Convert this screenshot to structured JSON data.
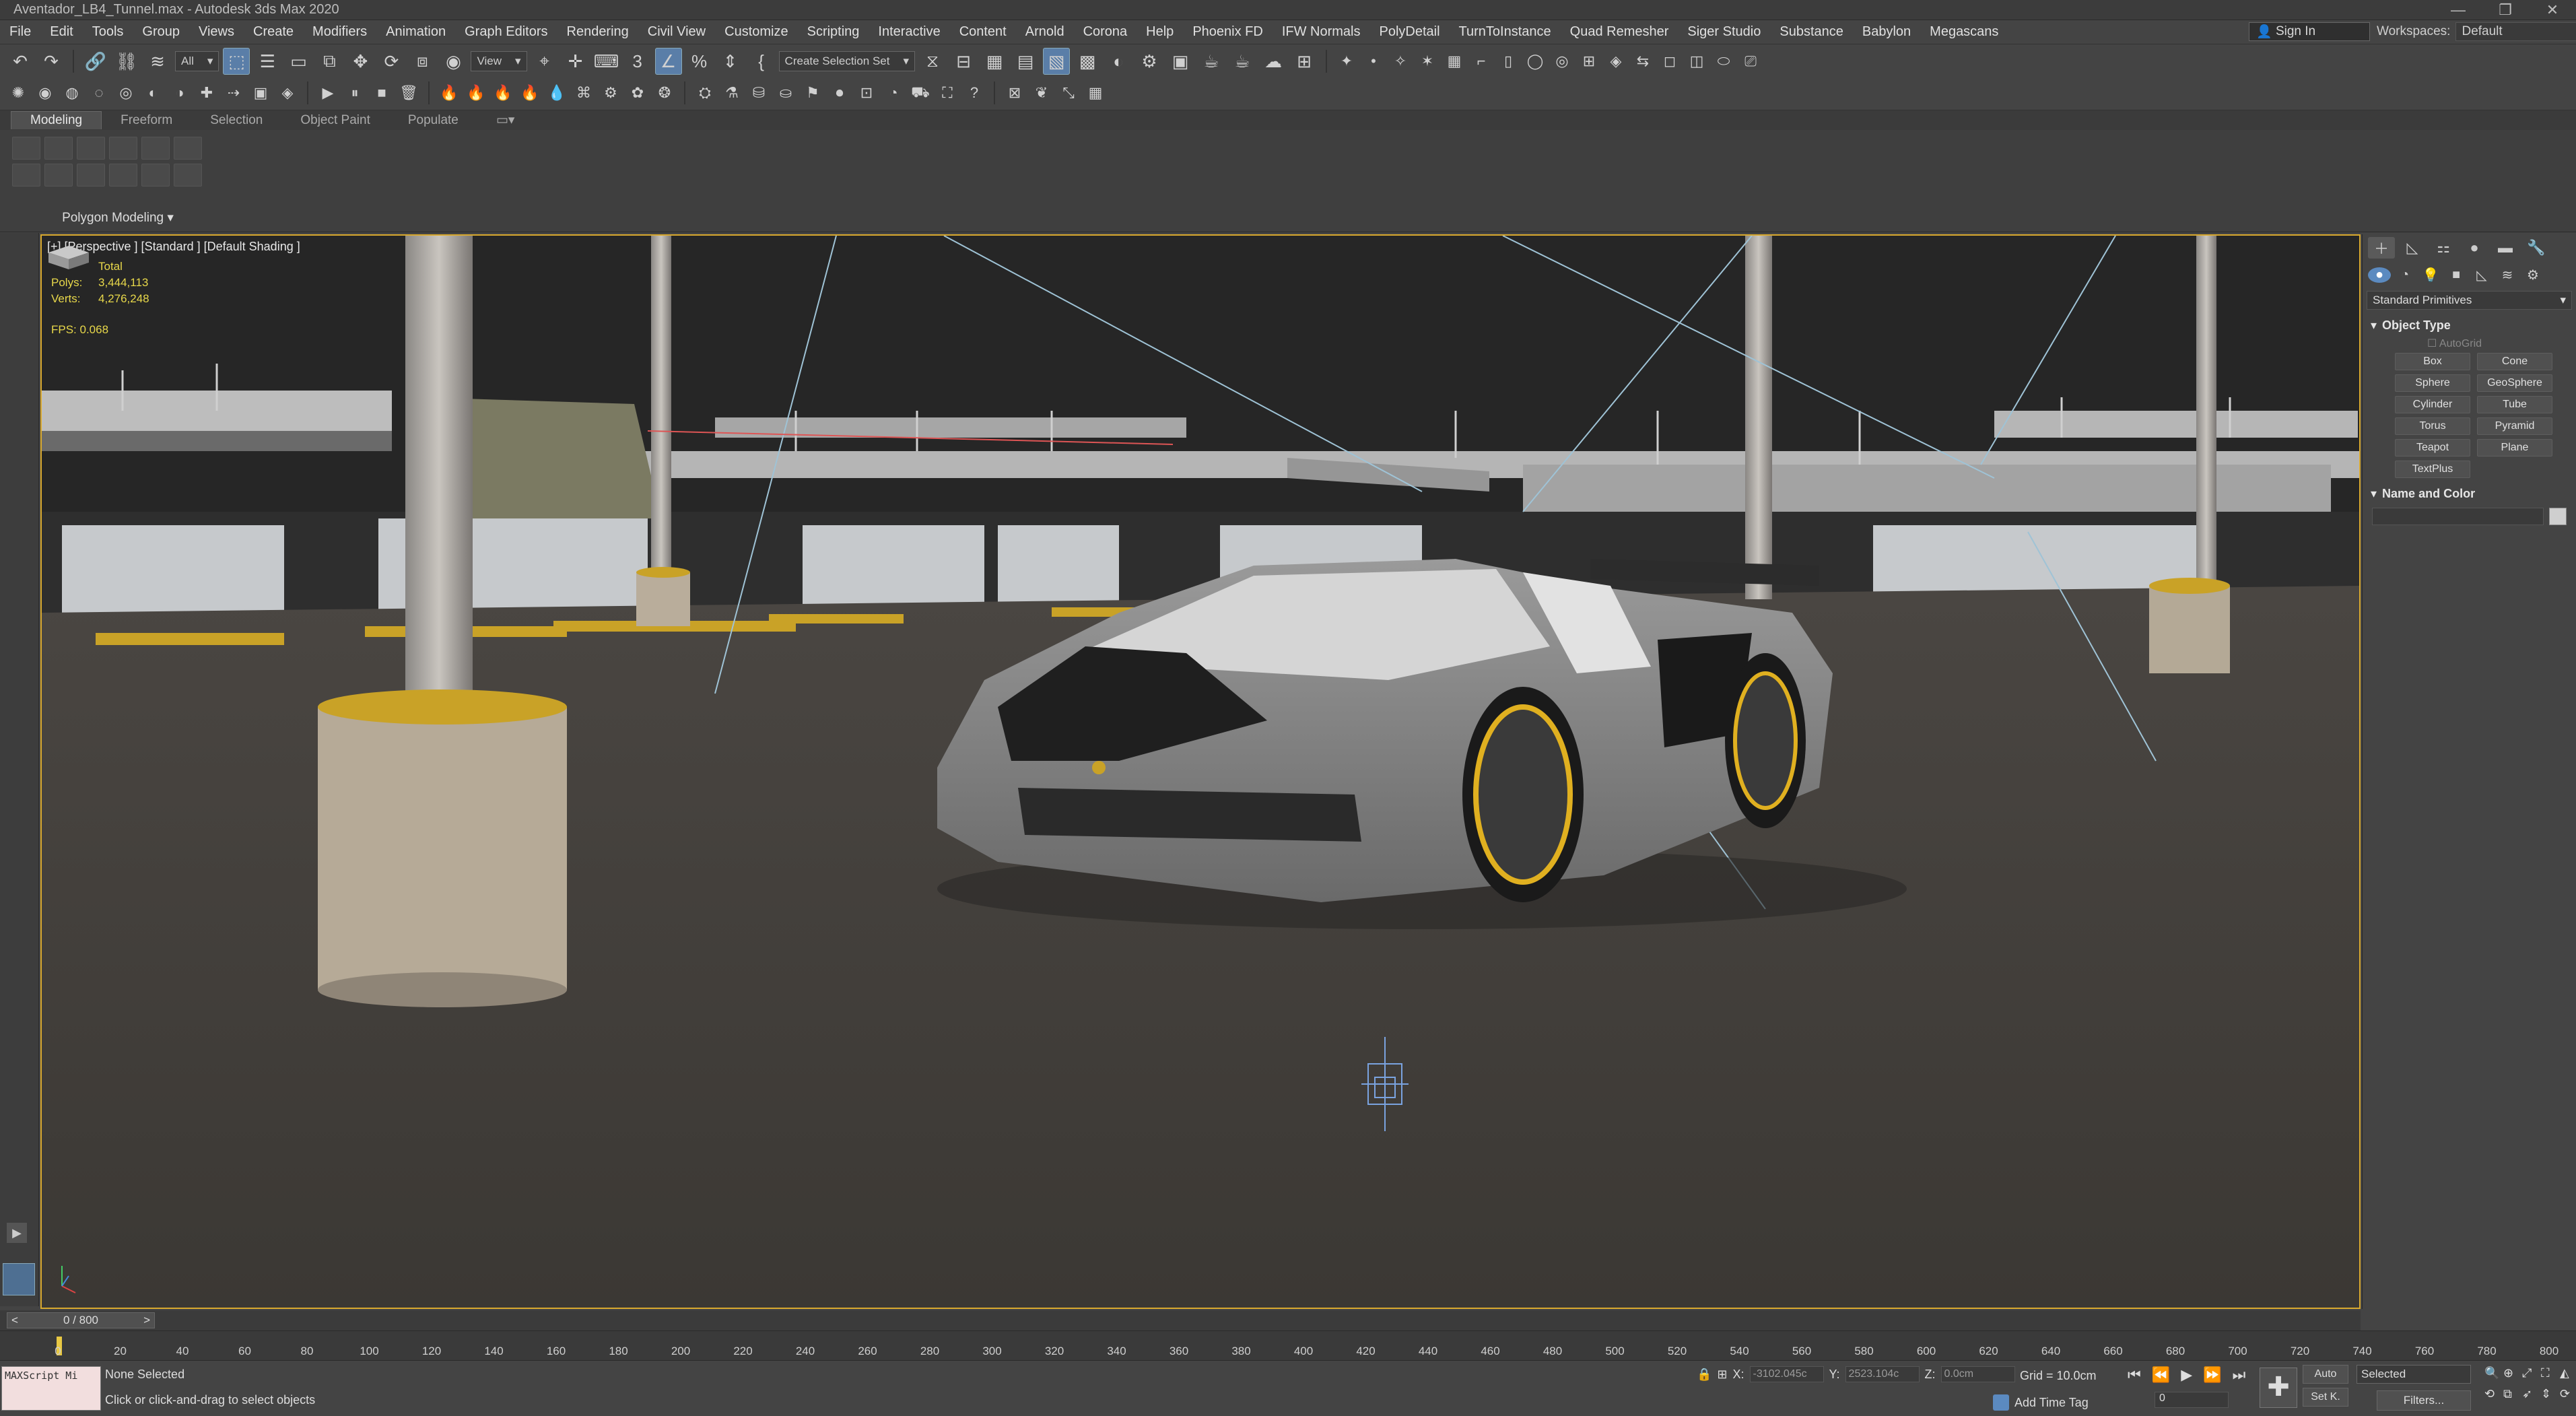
{
  "window": {
    "title": "Aventador_LB4_Tunnel.max - Autodesk 3ds Max 2020"
  },
  "menu": [
    "File",
    "Edit",
    "Tools",
    "Group",
    "Views",
    "Create",
    "Modifiers",
    "Animation",
    "Graph Editors",
    "Rendering",
    "Civil View",
    "Customize",
    "Scripting",
    "Interactive",
    "Content",
    "Arnold",
    "Corona",
    "Help",
    "Phoenix FD",
    "IFW Normals",
    "PolyDetail",
    "TurnToInstance",
    "Quad Remesher",
    "Siger Studio",
    "Substance",
    "Babylon",
    "Megascans"
  ],
  "signin": "Sign In",
  "workspaces": {
    "label": "Workspaces:",
    "value": "Default"
  },
  "toolbar": {
    "filter": "All",
    "ref_coord": "View",
    "selection_set": "Create Selection Set"
  },
  "ribbon": {
    "tabs": [
      "Modeling",
      "Freeform",
      "Selection",
      "Object Paint",
      "Populate"
    ],
    "active": "Modeling",
    "group_label": "Polygon Modeling"
  },
  "viewport": {
    "label": "[+] [Perspective ] [Standard ] [Default Shading ]",
    "stats": {
      "total_label": "Total",
      "polys_label": "Polys:",
      "polys": "3,444,113",
      "verts_label": "Verts:",
      "verts": "4,276,248"
    },
    "fps": "FPS:  0.068"
  },
  "command_panel": {
    "category": "Standard Primitives",
    "object_type": "Object Type",
    "autogrid": "AutoGrid",
    "primitives": [
      "Box",
      "Cone",
      "Sphere",
      "GeoSphere",
      "Cylinder",
      "Tube",
      "Torus",
      "Pyramid",
      "Teapot",
      "Plane",
      "TextPlus"
    ],
    "name_and_color": "Name and Color"
  },
  "time": {
    "frame": "0 / 800",
    "ticks": [
      "0",
      "20",
      "40",
      "60",
      "80",
      "100",
      "120",
      "140",
      "160",
      "180",
      "200",
      "220",
      "240",
      "260",
      "280",
      "300",
      "320",
      "340",
      "360",
      "380",
      "400",
      "420",
      "440",
      "460",
      "480",
      "500",
      "520",
      "540",
      "560",
      "580",
      "600",
      "620",
      "640",
      "660",
      "680",
      "700",
      "720",
      "740",
      "760",
      "780",
      "800"
    ]
  },
  "status": {
    "maxscript": "MAXScript Mi",
    "selection": "None Selected",
    "prompt": "Click or click-and-drag to select objects",
    "x_label": "X:",
    "x": "-3102.045c",
    "y_label": "Y:",
    "y": "2523.104c",
    "z_label": "Z:",
    "z": "0.0cm",
    "grid": "Grid = 10.0cm",
    "add_time_tag": "Add Time Tag",
    "frame_value": "0",
    "auto": "Auto",
    "setk": "Set K.",
    "selected": "Selected",
    "filters": "Filters..."
  },
  "colors": {
    "accent": "#5b9bd5",
    "viewport_border": "#d9a92e",
    "stats": "#e8d84a",
    "car": "#8c8c8c"
  }
}
